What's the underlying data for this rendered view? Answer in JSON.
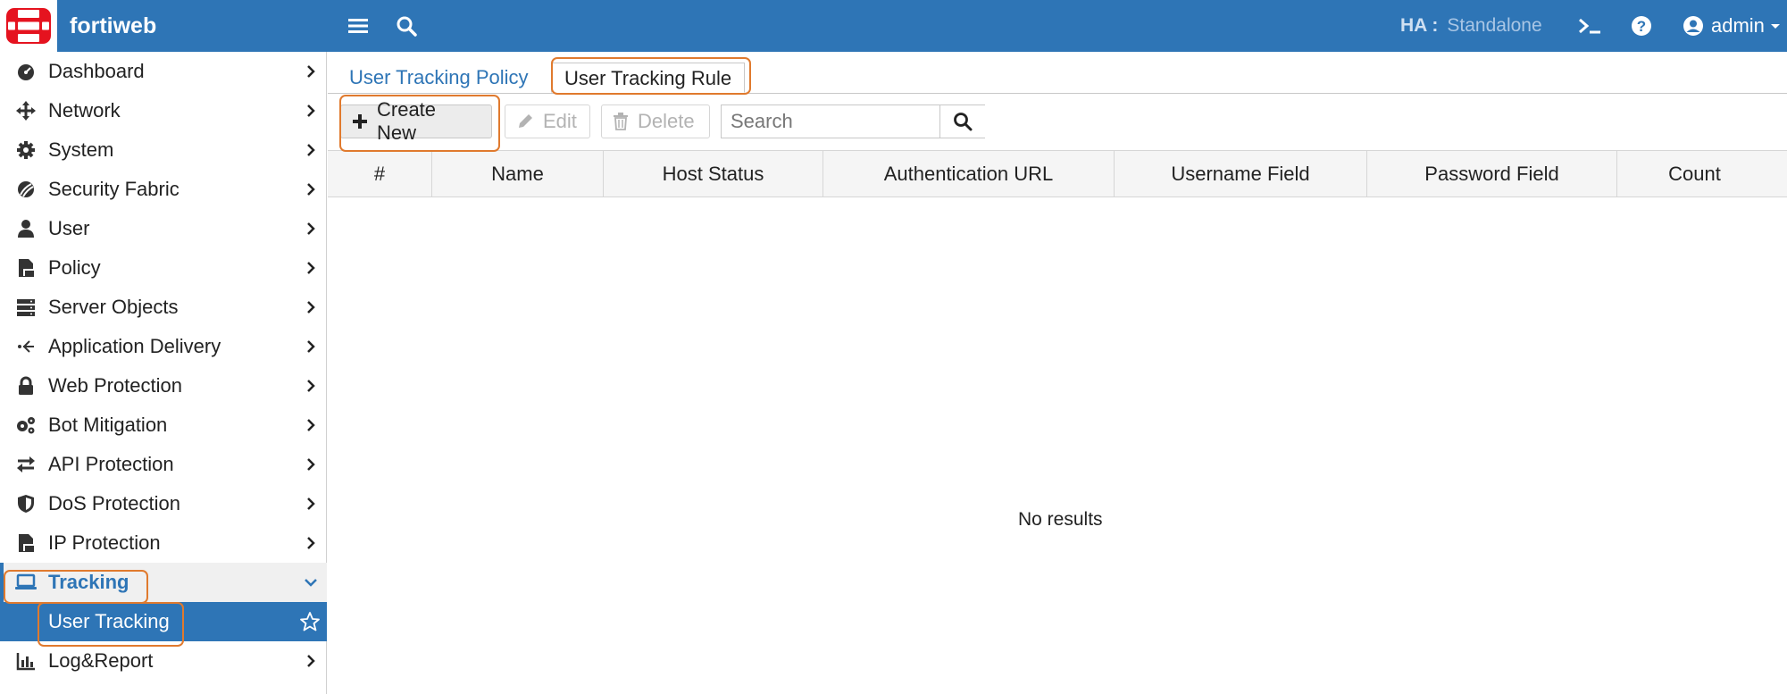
{
  "topbar": {
    "brand": "fortiweb",
    "ha_label": "HA :",
    "ha_value": "Standalone",
    "user": "admin",
    "accent": "#2e75b6"
  },
  "sidebar": {
    "items": [
      {
        "label": "Dashboard",
        "icon": "dashboard-icon"
      },
      {
        "label": "Network",
        "icon": "network-icon"
      },
      {
        "label": "System",
        "icon": "gear-icon"
      },
      {
        "label": "Security Fabric",
        "icon": "security-fabric-icon"
      },
      {
        "label": "User",
        "icon": "user-icon"
      },
      {
        "label": "Policy",
        "icon": "policy-icon"
      },
      {
        "label": "Server Objects",
        "icon": "server-icon"
      },
      {
        "label": "Application Delivery",
        "icon": "app-delivery-icon"
      },
      {
        "label": "Web Protection",
        "icon": "lock-icon"
      },
      {
        "label": "Bot Mitigation",
        "icon": "bot-icon"
      },
      {
        "label": "API Protection",
        "icon": "api-icon"
      },
      {
        "label": "DoS Protection",
        "icon": "shield-icon"
      },
      {
        "label": "IP Protection",
        "icon": "ip-protection-icon"
      },
      {
        "label": "Tracking",
        "icon": "laptop-icon"
      },
      {
        "label": "User Tracking",
        "icon": "star-icon"
      },
      {
        "label": "Log&Report",
        "icon": "chart-icon"
      }
    ]
  },
  "tabs": [
    {
      "label": "User Tracking Policy"
    },
    {
      "label": "User Tracking Rule"
    }
  ],
  "toolbar": {
    "create_label": "Create New",
    "edit_label": "Edit",
    "delete_label": "Delete",
    "search_placeholder": "Search"
  },
  "table": {
    "columns": [
      "#",
      "Name",
      "Host Status",
      "Authentication URL",
      "Username Field",
      "Password Field",
      "Count"
    ],
    "empty_text": "No results"
  },
  "colors": {
    "highlight": "#e07a2e",
    "active_row": "#2e75b6"
  }
}
